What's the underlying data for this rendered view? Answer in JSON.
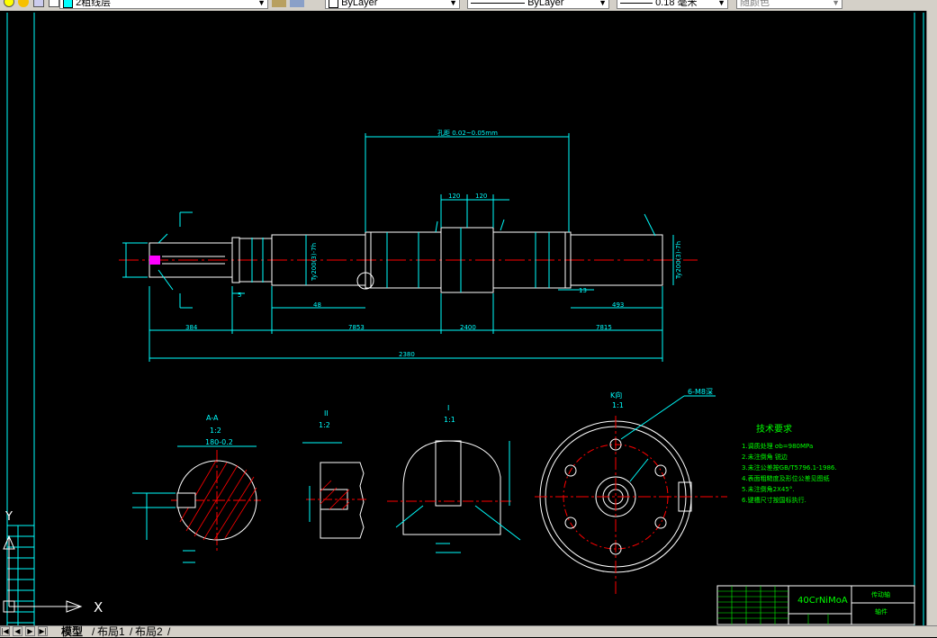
{
  "toolbar": {
    "layer_name": "2粗线层",
    "color_value": "ByLayer",
    "linetype_value": "ByLayer",
    "lineweight_value": "0.18 毫米",
    "plotstyle_value": "随颜色"
  },
  "drawing": {
    "dim_overall": "2380",
    "dim_left_end": "384",
    "dim_mid_left": "7853",
    "dim_center": "2400",
    "dim_mid_right": "7815",
    "dim_left_seg": "48",
    "dim_right_seg": "493",
    "dim_top_span": "孔距  0.02~0.05mm",
    "dim_120_a": "120",
    "dim_120_b": "120",
    "dim_13": "13",
    "dim_5": "5",
    "fit_label": "Ty200(3)-7h",
    "section_aa_title": "A-A",
    "section_aa_scale": "1:2",
    "section_aa_dim": "180-0.2",
    "section_ii_title": "II",
    "section_ii_scale": "1:2",
    "section_i_title": "I",
    "section_i_scale": "1:1",
    "view_k_title": "K向",
    "view_k_scale": "1:1",
    "view_k_hole_note": "6-M8深",
    "tech_title": "技术要求",
    "tech_notes": [
      "1.调质处理 σb=980MPa",
      "2.未注倒角 锐边",
      "3.未注公差按GB/T5796.1-1986.",
      "4.表面粗糙度及形位公差见图纸",
      "5.未注倒角2X45°.",
      "6.键槽尺寸按国标执行."
    ],
    "material": "40CrNiMoA",
    "title_name": "传动轴",
    "title_code": "轴件"
  },
  "ucs": {
    "x_label": "X",
    "y_label": "Y"
  },
  "tabs": {
    "model": "模型",
    "layout1": "布局1",
    "layout2": "布局2"
  },
  "colors": {
    "cyan": "#00ffff",
    "green": "#00ff00",
    "red": "#ff0000",
    "white": "#ffffff",
    "magenta": "#ff00ff"
  }
}
